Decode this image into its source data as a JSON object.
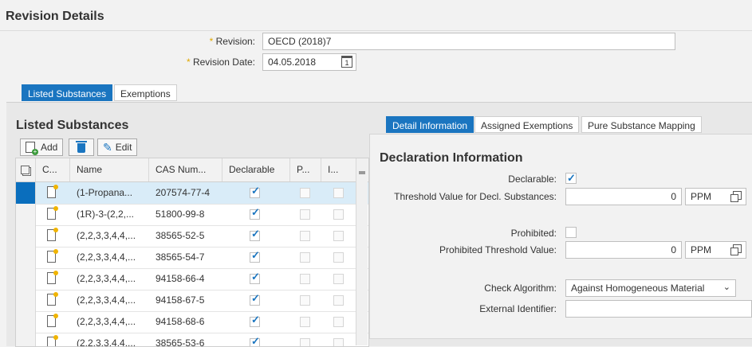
{
  "header": {
    "title": "Revision Details"
  },
  "form": {
    "revision_label": "Revision:",
    "revision_value": "OECD (2018)7",
    "revision_date_label": "Revision Date:",
    "revision_date_value": "04.05.2018",
    "calendar_day": "1",
    "required_mark": "*"
  },
  "tabs": {
    "listed": "Listed Substances",
    "exemptions": "Exemptions"
  },
  "listed": {
    "title": "Listed Substances",
    "toolbar": {
      "add": "Add",
      "edit": "Edit"
    },
    "columns": {
      "c": "C...",
      "name": "Name",
      "cas": "CAS Num...",
      "declarable": "Declarable",
      "p": "P...",
      "i": "I..."
    },
    "rows": [
      {
        "name": "(1-Propana...",
        "cas": "207574-77-4",
        "declarable": true,
        "selected": true
      },
      {
        "name": "(1R)-3-(2,2,...",
        "cas": "51800-99-8",
        "declarable": true
      },
      {
        "name": "(2,2,3,3,4,4,...",
        "cas": "38565-52-5",
        "declarable": true
      },
      {
        "name": "(2,2,3,3,4,4,...",
        "cas": "38565-54-7",
        "declarable": true
      },
      {
        "name": "(2,2,3,3,4,4,...",
        "cas": "94158-66-4",
        "declarable": true
      },
      {
        "name": "(2,2,3,3,4,4,...",
        "cas": "94158-67-5",
        "declarable": true
      },
      {
        "name": "(2,2,3,3,4,4,...",
        "cas": "94158-68-6",
        "declarable": true
      },
      {
        "name": "(2,2,3,3,4,4,...",
        "cas": "38565-53-6",
        "declarable": true
      }
    ]
  },
  "detail_tabs": {
    "detail": "Detail Information",
    "assigned": "Assigned Exemptions",
    "mapping": "Pure Substance Mapping"
  },
  "declaration": {
    "title": "Declaration Information",
    "declarable_label": "Declarable:",
    "declarable_checked": true,
    "threshold_label": "Threshold Value for Decl. Substances:",
    "threshold_value": "0",
    "threshold_unit": "PPM",
    "prohibited_label": "Prohibited:",
    "prohibited_checked": false,
    "prohibited_threshold_label": "Prohibited Threshold Value:",
    "prohibited_threshold_value": "0",
    "prohibited_threshold_unit": "PPM",
    "check_algorithm_label": "Check Algorithm:",
    "check_algorithm_value": "Against Homogeneous Material",
    "external_identifier_label": "External Identifier:",
    "external_identifier_value": ""
  },
  "colors": {
    "accent": "#1a75c0",
    "selected_row": "#d9ecf8",
    "required": "#e0a800"
  }
}
